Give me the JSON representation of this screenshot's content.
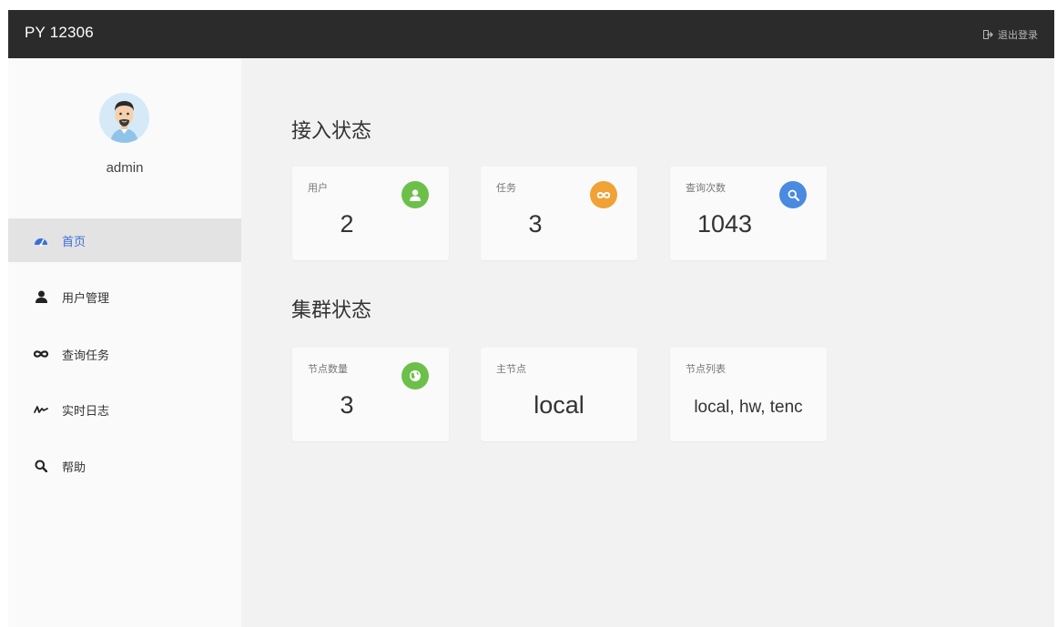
{
  "header": {
    "brand": "PY 12306",
    "logout_label": "退出登录"
  },
  "sidebar": {
    "username": "admin",
    "items": [
      {
        "label": "首页",
        "icon": "dashboard-icon",
        "active": true
      },
      {
        "label": "用户管理",
        "icon": "user-icon",
        "active": false
      },
      {
        "label": "查询任务",
        "icon": "infinity-icon",
        "active": false
      },
      {
        "label": "实时日志",
        "icon": "signal-line-icon",
        "active": false
      },
      {
        "label": "帮助",
        "icon": "search-icon",
        "active": false
      }
    ]
  },
  "main": {
    "access_section": {
      "title": "接入状态",
      "cards": [
        {
          "label": "用户",
          "value": "2",
          "icon": "user-icon",
          "color": "#6cc04a"
        },
        {
          "label": "任务",
          "value": "3",
          "icon": "infinity-icon",
          "color": "#f0a235"
        },
        {
          "label": "查询次数",
          "value": "1043",
          "icon": "search-icon",
          "color": "#4a8ae0"
        }
      ]
    },
    "cluster_section": {
      "title": "集群状态",
      "cards": [
        {
          "label": "节点数量",
          "value": "3",
          "icon": "globe-icon",
          "color": "#6cc04a"
        },
        {
          "label": "主节点",
          "value": "local"
        },
        {
          "label": "节点列表",
          "value": "local, hw, tenc"
        }
      ]
    }
  },
  "colors": {
    "topbar": "#2b2b2b",
    "active_nav_text": "#3a6fd8",
    "green": "#6cc04a",
    "orange": "#f0a235",
    "blue": "#4a8ae0"
  }
}
